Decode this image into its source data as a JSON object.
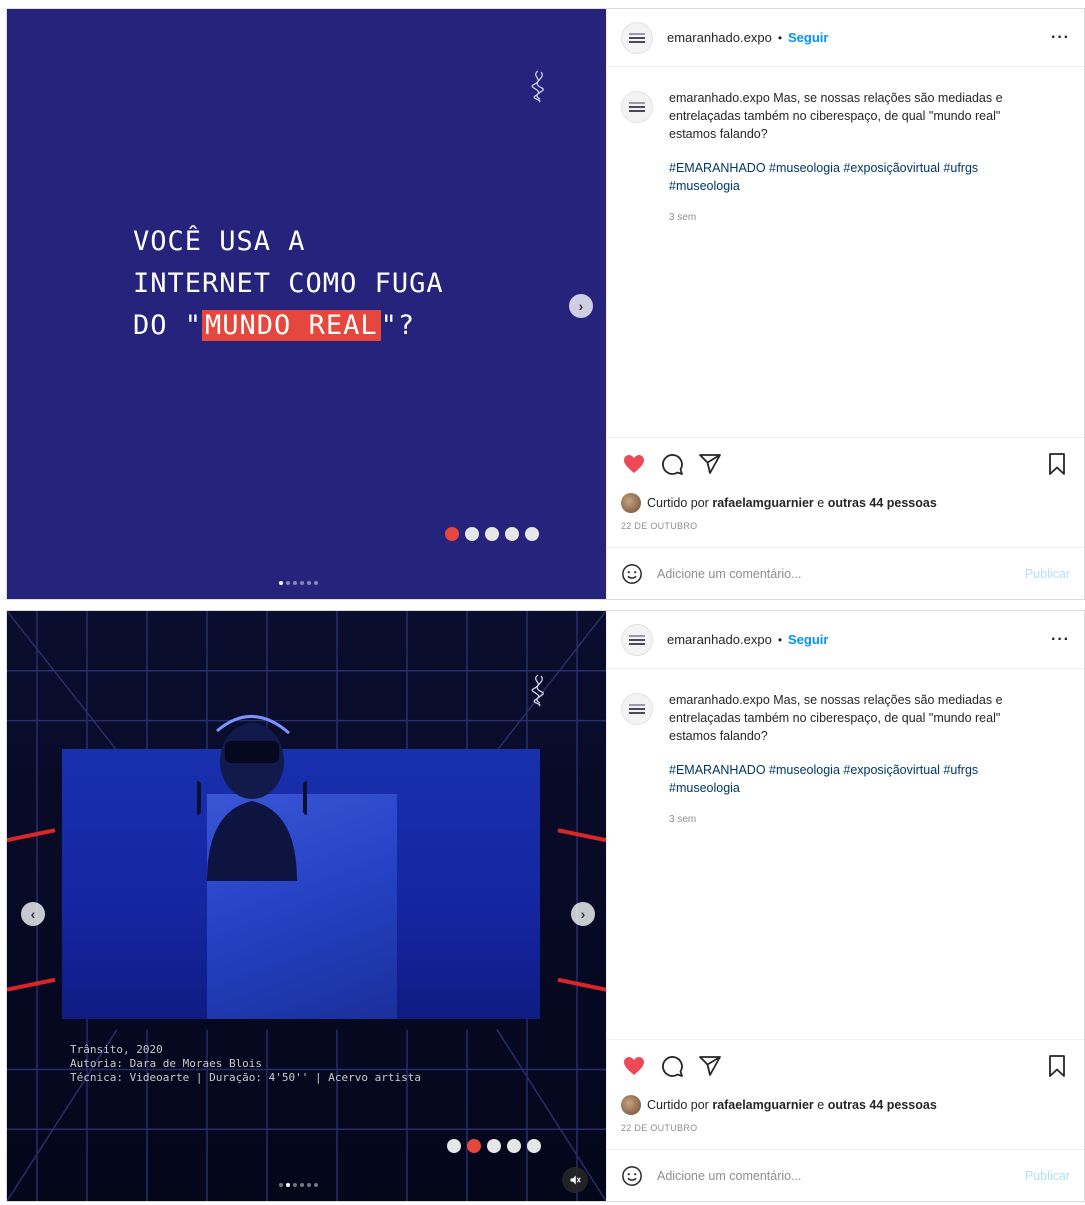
{
  "posts": [
    {
      "account": {
        "username": "emaranhado.expo",
        "separator": "•",
        "follow_label": "Seguir",
        "more_label": "···"
      },
      "caption": {
        "username": "emaranhado.expo",
        "text": "Mas, se nossas relações são mediadas e entrelaçadas também no ciberespaço, de qual \"mundo real\" estamos falando?",
        "hashtags": "#EMARANHADO #museologia #exposiçãovirtual #ufrgs #museologia",
        "time": "3 sem"
      },
      "likes": {
        "prefix": "Curtido por",
        "user": "rafaelamguarnier",
        "middle": "e",
        "others": "outras 44 pessoas"
      },
      "date": "22 DE OUTUBRO",
      "comment": {
        "placeholder": "Adicione um comentário...",
        "publish_label": "Publicar"
      },
      "slide": {
        "line1": "VOCÊ USA A",
        "line2": "INTERNET COMO FUGA",
        "line3_pre": "DO \"",
        "line3_highlight": "MUNDO REAL",
        "line3_post": "\"?",
        "active_dot": 0
      }
    },
    {
      "account": {
        "username": "emaranhado.expo",
        "separator": "•",
        "follow_label": "Seguir",
        "more_label": "···"
      },
      "caption": {
        "username": "emaranhado.expo",
        "text": "Mas, se nossas relações são mediadas e entrelaçadas também no ciberespaço, de qual \"mundo real\" estamos falando?",
        "hashtags": "#EMARANHADO #museologia #exposiçãovirtual #ufrgs #museologia",
        "time": "3 sem"
      },
      "likes": {
        "prefix": "Curtido por",
        "user": "rafaelamguarnier",
        "middle": "e",
        "others": "outras 44 pessoas"
      },
      "date": "22 DE OUTUBRO",
      "comment": {
        "placeholder": "Adicione um comentário...",
        "publish_label": "Publicar"
      },
      "slide": {
        "caption_line1": "Trânsito, 2020",
        "caption_line2": "Autoria: Dara de Moraes Blois",
        "caption_line3": "Técnica: Videoarte | Duração: 4'50'' | Acervo artista",
        "active_dot": 1
      }
    }
  ],
  "icons": {
    "like": "heart-icon",
    "comment": "comment-icon",
    "share": "share-icon",
    "save": "bookmark-icon",
    "emoji": "smiley-icon",
    "next": "chevron-right-icon",
    "prev": "chevron-left-icon",
    "mute": "muted-speaker-icon"
  },
  "colors": {
    "like": "#ed4956",
    "link": "#0095f6",
    "slide_bg": "#25237c",
    "highlight": "#e5473c"
  },
  "carousel": {
    "slide_count": 5,
    "mini_dot_count": 6
  }
}
